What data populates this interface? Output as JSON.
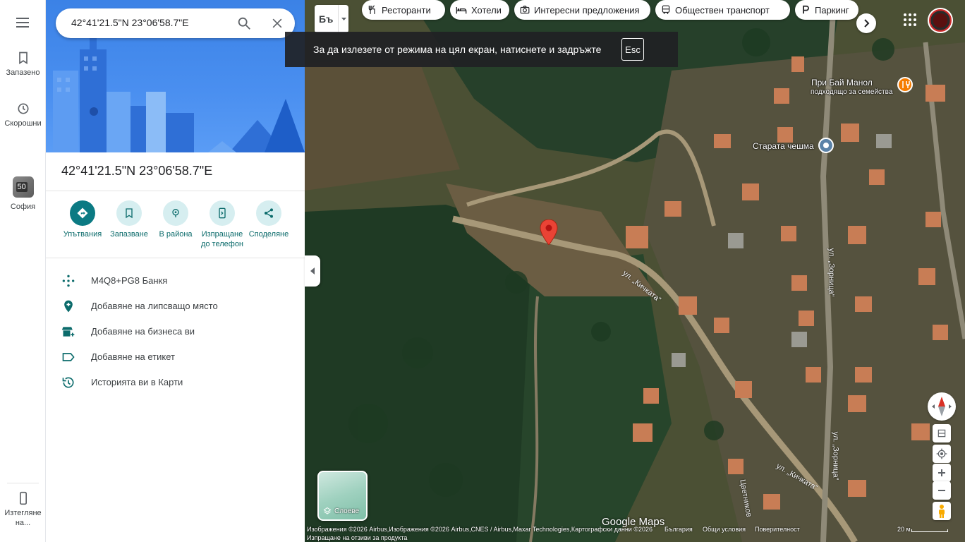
{
  "rail": {
    "saved": "Запазено",
    "recent": "Скорошни",
    "sofia_badge": "50",
    "sofia": "София",
    "download": "Изтегляне на..."
  },
  "search": {
    "value": "42°41'21.5\"N 23°06'58.7\"E"
  },
  "place": {
    "title": "42°41'21.5\"N 23°06'58.7\"E"
  },
  "actions": [
    {
      "label": "Упътвания",
      "icon": "directions-icon"
    },
    {
      "label": "Запазване",
      "icon": "bookmark-icon"
    },
    {
      "label": "В района",
      "icon": "nearby-icon"
    },
    {
      "label": "Изпращане до телефон",
      "icon": "send-to-phone-icon"
    },
    {
      "label": "Споделяне",
      "icon": "share-icon"
    }
  ],
  "list": [
    {
      "label": "M4Q8+PG8 Банкя",
      "icon": "plus-code-icon"
    },
    {
      "label": "Добавяне на липсващо място",
      "icon": "add-place-icon"
    },
    {
      "label": "Добавяне на бизнеса ви",
      "icon": "add-business-icon"
    },
    {
      "label": "Добавяне на етикет",
      "icon": "label-icon"
    },
    {
      "label": "Историята ви в Карти",
      "icon": "history-icon"
    }
  ],
  "map": {
    "lang_label": "Бъ",
    "chips": [
      {
        "label": "Ресторанти",
        "icon": "restaurant-icon"
      },
      {
        "label": "Хотели",
        "icon": "hotel-icon"
      },
      {
        "label": "Интересни предложения",
        "icon": "camera-icon"
      },
      {
        "label": "Обществен транспорт",
        "icon": "transit-icon"
      },
      {
        "label": "Паркинг",
        "icon": "parking-icon"
      }
    ],
    "fullscreen_notice": "За да излезете от режима на цял екран, натиснете и задръжте",
    "fullscreen_key": "Esc",
    "poi": [
      {
        "label": "При Бай Манол",
        "sub": "подходящо за семейства"
      },
      {
        "label": "Старата чешма",
        "sub": ""
      }
    ],
    "streets": [
      "ул. „Кичката“",
      "ул. „Зорница“",
      "ул. „Зорница“",
      "ул. „Кичката“",
      "Цветников"
    ],
    "layers_label": "Слоеве",
    "brand": "Google Maps",
    "footer": {
      "attribution": "Изображения ©2026 Airbus,Изображения ©2026 Airbus,CNES / Airbus,Maxar Technologies,Картографски данни ©2026",
      "links": [
        "България",
        "Общи условия",
        "Поверителност"
      ],
      "scale": "20 м",
      "feedback": "Изпращане на отзиви за продукта"
    }
  },
  "colors": {
    "accent": "#0b7a83",
    "hero": "#4a8ff0",
    "pin": "#ea4335"
  }
}
